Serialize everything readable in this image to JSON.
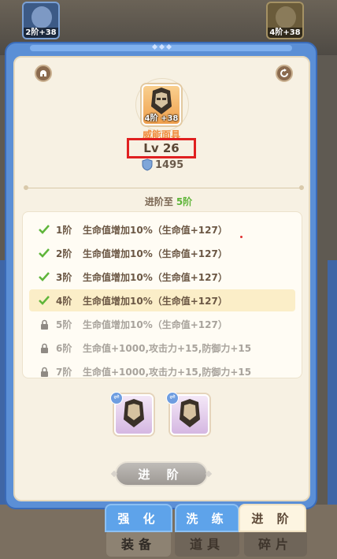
{
  "background": {
    "slot_left_label": "2阶+38",
    "slot_right_label": "4阶+38",
    "bottom_tabs": [
      "装备",
      "道具",
      "碎片"
    ]
  },
  "item": {
    "name": "威能面具",
    "badge": "4阶 +38",
    "level": "Lv 26",
    "power": "1495"
  },
  "advance": {
    "label": "进阶至",
    "target": "5阶",
    "button": "进 阶"
  },
  "stages": [
    {
      "stage": "1阶",
      "desc": "生命值增加10%（生命值+127）",
      "status": "done"
    },
    {
      "stage": "2阶",
      "desc": "生命值增加10%（生命值+127）",
      "status": "done"
    },
    {
      "stage": "3阶",
      "desc": "生命值增加10%（生命值+127）",
      "status": "done"
    },
    {
      "stage": "4阶",
      "desc": "生命值增加10%（生命值+127）",
      "status": "current"
    },
    {
      "stage": "5阶",
      "desc": "生命值增加10%（生命值+127）",
      "status": "locked"
    },
    {
      "stage": "6阶",
      "desc": "生命值+1000,攻击力+15,防御力+15",
      "status": "locked"
    },
    {
      "stage": "7阶",
      "desc": "生命值+1000,攻击力+15,防御力+15",
      "status": "locked"
    }
  ],
  "tabs": [
    "强 化",
    "洗 练",
    "进 阶"
  ],
  "colors": {
    "panel_blue": "#5b8fd6",
    "cream": "#f7f1e3",
    "check_green": "#5fb53a",
    "highlight_red": "#e02020",
    "orange_name": "#f08a3a"
  },
  "icons": {
    "left_corner": "helmet-icon",
    "right_corner": "refresh-icon",
    "done": "check-icon",
    "locked": "lock-icon",
    "power": "shield-icon"
  }
}
